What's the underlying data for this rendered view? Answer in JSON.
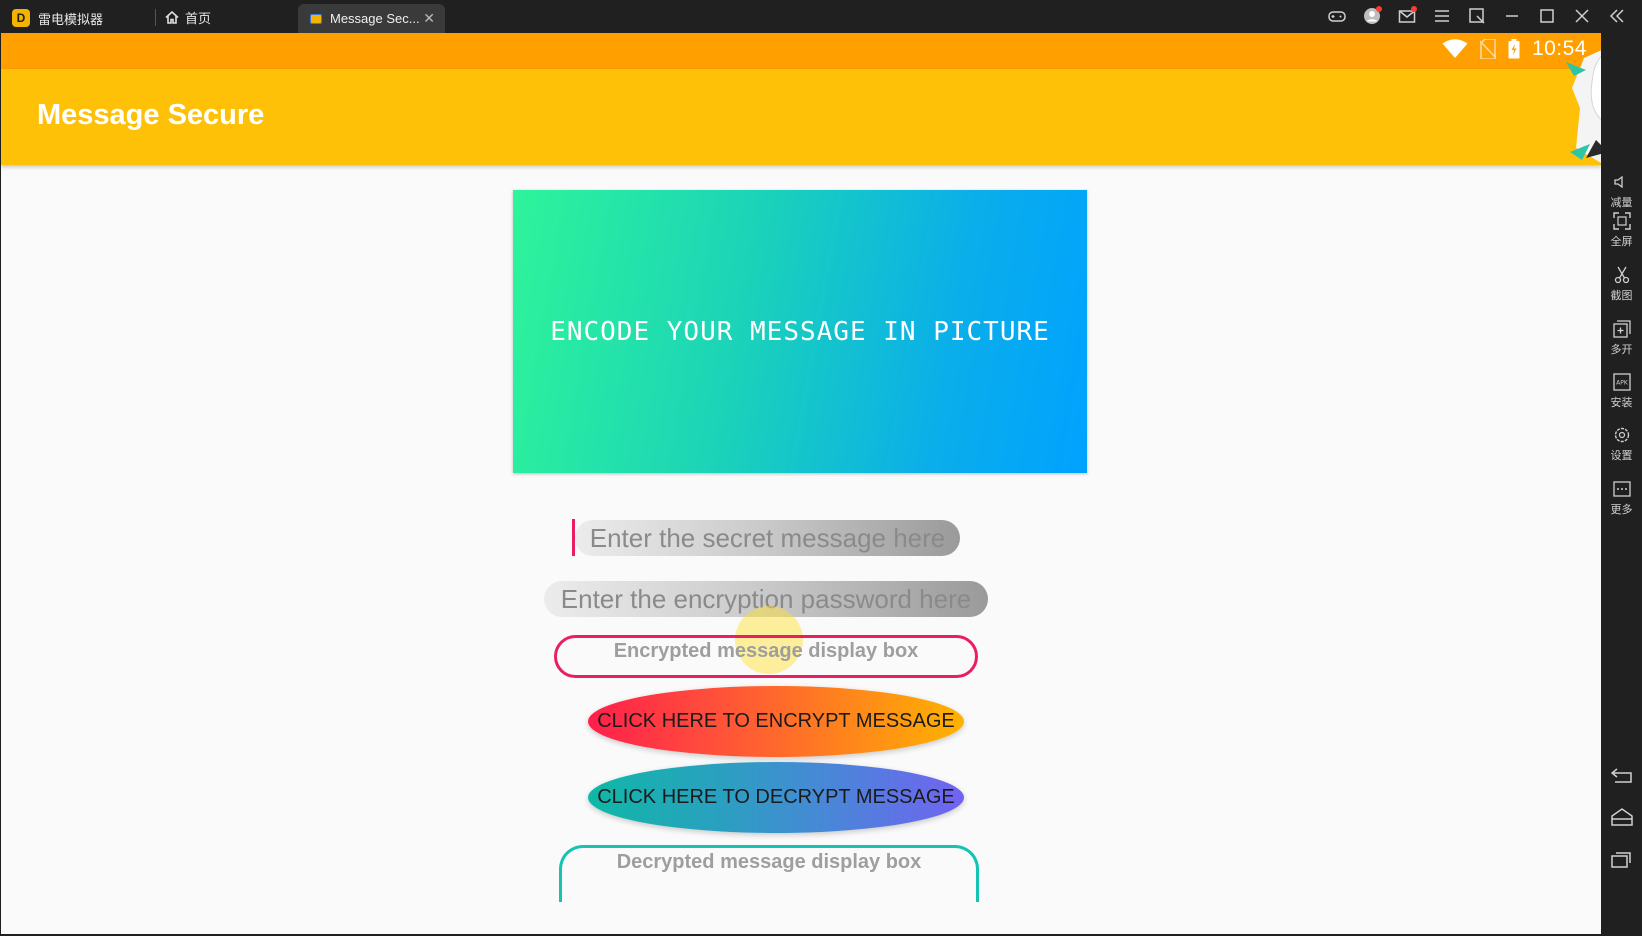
{
  "emulator": {
    "app_name": "雷电模拟器",
    "home_tab": "首页",
    "active_tab": "Message Sec...",
    "sidebar": [
      {
        "label": "减量",
        "icon": "volume-down-icon"
      },
      {
        "label": "全屏",
        "icon": "fullscreen-icon"
      },
      {
        "label": "截图",
        "icon": "scissors-icon"
      },
      {
        "label": "多开",
        "icon": "multi-instance-icon"
      },
      {
        "label": "安装",
        "icon": "apk-install-icon"
      },
      {
        "label": "设置",
        "icon": "settings-gear-icon"
      },
      {
        "label": "更多",
        "icon": "more-icon"
      }
    ]
  },
  "status_bar": {
    "time": "10:54"
  },
  "app": {
    "title": "Message Secure",
    "banner_text": "ENCODE YOUR MESSAGE IN PICTURE",
    "secret_placeholder": "Enter the secret message here",
    "password_placeholder": "Enter the encryption password here",
    "encrypted_box_label": "Encrypted message display box",
    "encrypt_button": "CLICK HERE TO ENCRYPT MESSAGE",
    "decrypt_button": "CLICK HERE TO DECRYPT MESSAGE",
    "decrypted_box_label": "Decrypted message display box"
  },
  "colors": {
    "status_bar": "#ff9f00",
    "app_bar": "#ffc107",
    "accent_pink": "#e91e63",
    "accent_teal": "#14c3b3"
  }
}
